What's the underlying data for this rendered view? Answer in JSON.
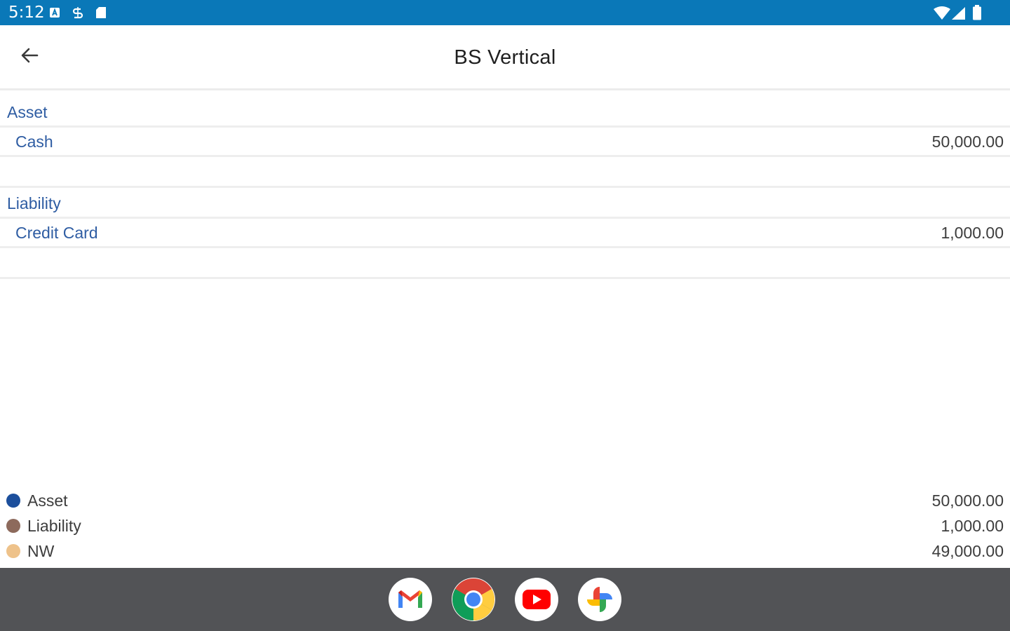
{
  "status_bar": {
    "time": "5:12",
    "left_icons": [
      "notification-a-icon",
      "notification-s-icon",
      "sd-card-icon"
    ],
    "right_icons": [
      "wifi-icon",
      "cellular-signal-icon",
      "battery-icon"
    ],
    "background_color": "#0a78b8"
  },
  "app_bar": {
    "title": "BS Vertical",
    "back_icon": "arrow-left-icon"
  },
  "sections": [
    {
      "header": "Asset",
      "rows": [
        {
          "name": "Cash",
          "value": "50,000.00"
        }
      ]
    },
    {
      "header": "Liability",
      "rows": [
        {
          "name": "Credit Card",
          "value": "1,000.00"
        }
      ]
    }
  ],
  "legend": [
    {
      "label": "Asset",
      "value": "50,000.00",
      "color": "#1c4f9c"
    },
    {
      "label": "Liability",
      "value": "1,000.00",
      "color": "#8d6a5c"
    },
    {
      "label": "NW",
      "value": "49,000.00",
      "color": "#eec28a"
    }
  ],
  "dock": {
    "apps": [
      "gmail-icon",
      "chrome-icon",
      "youtube-icon",
      "photos-icon"
    ],
    "background_color": "#525356"
  },
  "colors": {
    "accent_text": "#2f5da3",
    "value_text": "#3d3d3d"
  }
}
